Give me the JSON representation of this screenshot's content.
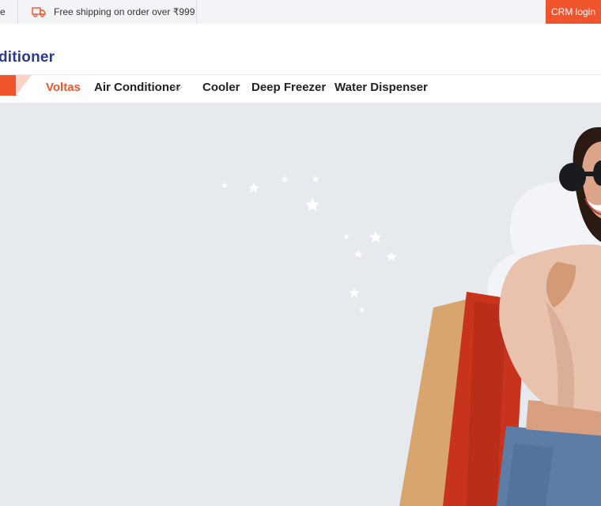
{
  "topbar": {
    "cut_text": "e",
    "shipping_text": "Free shipping on order over ₹999",
    "crm_login_label": "CRM login"
  },
  "logo": {
    "text": "ditioner"
  },
  "nav": {
    "items": [
      {
        "label": "Voltas",
        "active": true
      },
      {
        "label": "Air Conditioner",
        "has_dropdown": true
      },
      {
        "label": "Cooler"
      },
      {
        "label": "Deep Freezer"
      },
      {
        "label": "Water Dispenser"
      }
    ]
  },
  "colors": {
    "accent": "#f0542d",
    "brand_blue": "#2a3a8c",
    "hero_bg": "#e6e9ee"
  },
  "hero": {
    "image": "woman-with-shopping-bags-icon"
  }
}
